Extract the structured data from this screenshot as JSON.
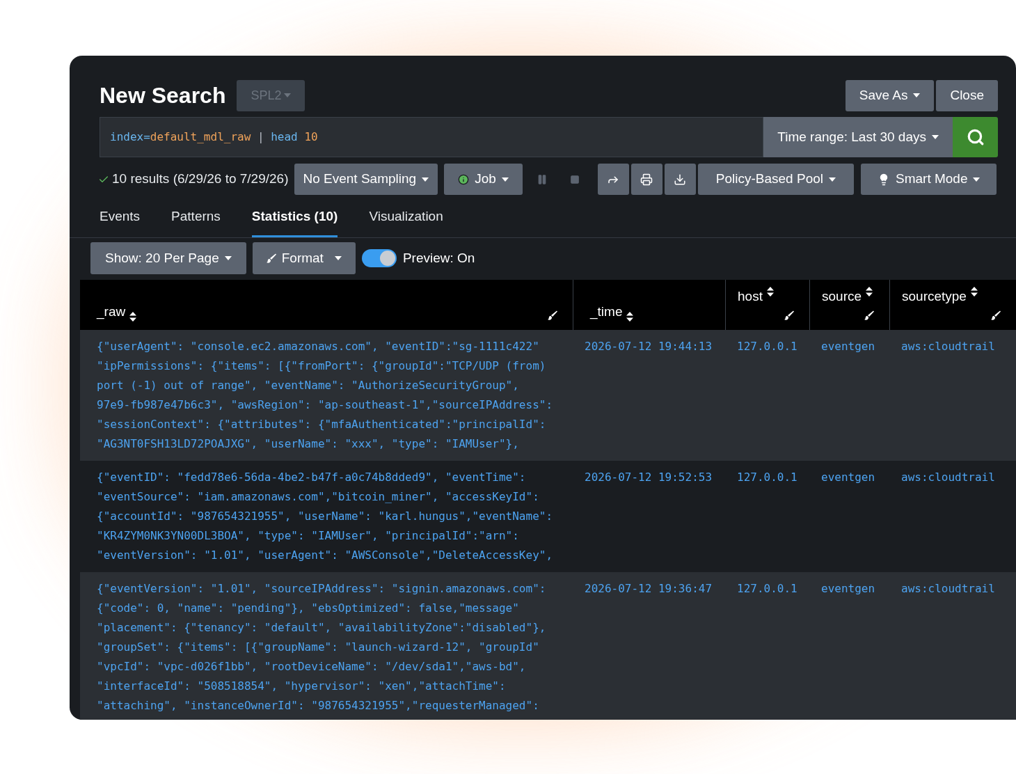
{
  "title": "New Search",
  "language_button": {
    "label": "SPL2",
    "disabled": true
  },
  "header_buttons": [
    {
      "label": "Save As",
      "dropdown": true
    },
    {
      "label": "Close",
      "dropdown": false
    }
  ],
  "query": [
    {
      "text": "index=",
      "kind": "keyword"
    },
    {
      "text": "default_mdl_raw",
      "kind": "value"
    },
    {
      "text": " | ",
      "kind": "plain"
    },
    {
      "text": "head ",
      "kind": "keyword"
    },
    {
      "text": "10",
      "kind": "value"
    }
  ],
  "time_range": {
    "label": "Time range: Last 30 days"
  },
  "results": {
    "label": "10 results (6/29/26 to 7/29/26)",
    "complete": true
  },
  "sampling": {
    "label": "No Event Sampling"
  },
  "job": {
    "label": "Job"
  },
  "pool": {
    "label": "Policy-Based Pool"
  },
  "mode": {
    "label": "Smart Mode"
  },
  "tabs": [
    {
      "label": "Events",
      "selected": false
    },
    {
      "label": "Patterns",
      "selected": false
    },
    {
      "label": "Statistics (10)",
      "selected": true
    },
    {
      "label": "Visualization",
      "selected": false
    }
  ],
  "show_button": {
    "label": "Show: 20 Per Page"
  },
  "format_button": {
    "label": "Format"
  },
  "preview": {
    "label": "Preview: On",
    "on": true
  },
  "table": {
    "columns": [
      {
        "label": "_raw",
        "format_icon": true
      },
      {
        "label": "_time",
        "format_icon": false
      },
      {
        "label": "host",
        "format_icon": true
      },
      {
        "label": "source",
        "format_icon": true
      },
      {
        "label": "sourcetype",
        "format_icon": true
      }
    ],
    "rows": [
      {
        "raw": [
          "{\"userAgent\": \"console.ec2.amazonaws.com\", \"eventID\":\"sg-1111c422\"",
          "\"ipPermissions\": {\"items\": [{\"fromPort\": {\"groupId\":\"TCP/UDP (from)",
          "port (-1) out of range\", \"eventName\": \"AuthorizeSecurityGroup\",",
          "97e9-fb987e47b6c3\", \"awsRegion\": \"ap-southeast-1\",\"sourceIPAddress\":",
          "\"sessionContext\": {\"attributes\": {\"mfaAuthenticated\":\"principalId\":",
          "\"AG3NT0FSH13LD72POAJXG\", \"userName\": \"xxx\", \"type\": \"IAMUser\"},"
        ],
        "time": "2026-07-12 19:44:13",
        "host": "127.0.0.1",
        "source": "eventgen",
        "sourcetype": "aws:cloudtrail"
      },
      {
        "raw": [
          "{\"eventID\": \"fedd78e6-56da-4be2-b47f-a0c74b8dded9\", \"eventTime\":",
          "\"eventSource\": \"iam.amazonaws.com\",\"bitcoin_miner\", \"accessKeyId\":",
          "{\"accountId\": \"987654321955\", \"userName\": \"karl.hungus\",\"eventName\":",
          "\"KR4ZYM0NK3YN00DL3BOA\", \"type\": \"IAMUser\", \"principalId\":\"arn\":",
          "\"eventVersion\": \"1.01\", \"userAgent\": \"AWSConsole\",\"DeleteAccessKey\","
        ],
        "time": "2026-07-12 19:52:53",
        "host": "127.0.0.1",
        "source": "eventgen",
        "sourcetype": "aws:cloudtrail"
      },
      {
        "raw": [
          "{\"eventVersion\": \"1.01\", \"sourceIPAddress\": \"signin.amazonaws.com\":",
          "{\"code\": 0, \"name\": \"pending\"}, \"ebsOptimized\": false,\"message\"",
          "\"placement\": {\"tenancy\": \"default\", \"availabilityZone\":\"disabled\"},",
          "\"groupSet\": {\"items\": [{\"groupName\": \"launch-wizard-12\", \"groupId\"",
          "\"vpcId\": \"vpc-d026f1bb\", \"rootDeviceName\": \"/dev/sda1\",\"aws-bd\",",
          "\"interfaceId\": \"508518854\", \"hypervisor\": \"xen\",\"attachTime\":",
          "\"attaching\", \"instanceOwnerId\": \"987654321955\",\"requesterManaged\":"
        ],
        "time": "2026-07-12 19:36:47",
        "host": "127.0.0.1",
        "source": "eventgen",
        "sourcetype": "aws:cloudtrail"
      }
    ]
  }
}
